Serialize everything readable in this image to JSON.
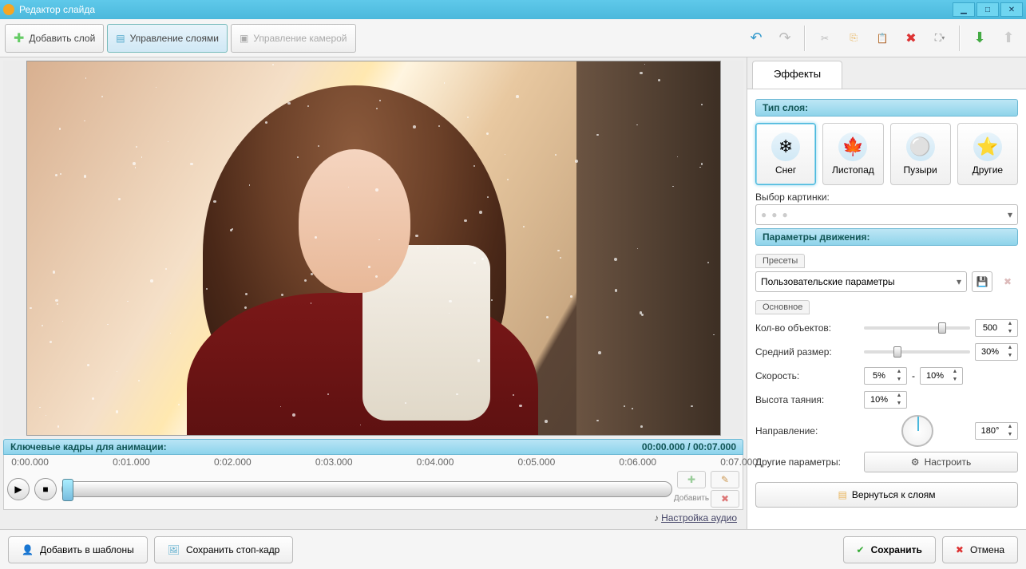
{
  "title": "Редактор слайда",
  "toolbar": {
    "add_layer": "Добавить слой",
    "manage_layers": "Управление слоями",
    "camera_control": "Управление камерой"
  },
  "timeline": {
    "header": "Ключевые кадры для анимации:",
    "time_display": "00:00.000 / 00:07.000",
    "ticks": [
      "0:00.000",
      "0:01.000",
      "0:02.000",
      "0:03.000",
      "0:04.000",
      "0:05.000",
      "0:06.000",
      "0:07.000"
    ],
    "add_btn": "Добавить",
    "audio_link": "Настройка аудио"
  },
  "side": {
    "tab_effects": "Эффекты",
    "section_layer_type": "Тип слоя:",
    "types": [
      {
        "label": "Снег",
        "icon": "❄"
      },
      {
        "label": "Листопад",
        "icon": "🍁"
      },
      {
        "label": "Пузыри",
        "icon": "⚪"
      },
      {
        "label": "Другие",
        "icon": "⭐"
      }
    ],
    "picture_select": "Выбор картинки:",
    "section_motion": "Параметры движения:",
    "presets_lbl": "Пресеты",
    "preset_value": "Пользовательские параметры",
    "main_lbl": "Основное",
    "rows": {
      "count": "Кол-во объектов:",
      "count_val": "500",
      "size": "Средний размер:",
      "size_val": "30%",
      "speed": "Скорость:",
      "speed_min": "5%",
      "speed_dash": "-",
      "speed_max": "10%",
      "melt": "Высота таяния:",
      "melt_val": "10%",
      "direction": "Направление:",
      "direction_val": "180°",
      "other_params": "Другие параметры:",
      "configure": "Настроить"
    },
    "back_btn": "Вернуться к слоям"
  },
  "footer": {
    "add_template": "Добавить в шаблоны",
    "save_frame": "Сохранить стоп-кадр",
    "save": "Сохранить",
    "cancel": "Отмена"
  }
}
